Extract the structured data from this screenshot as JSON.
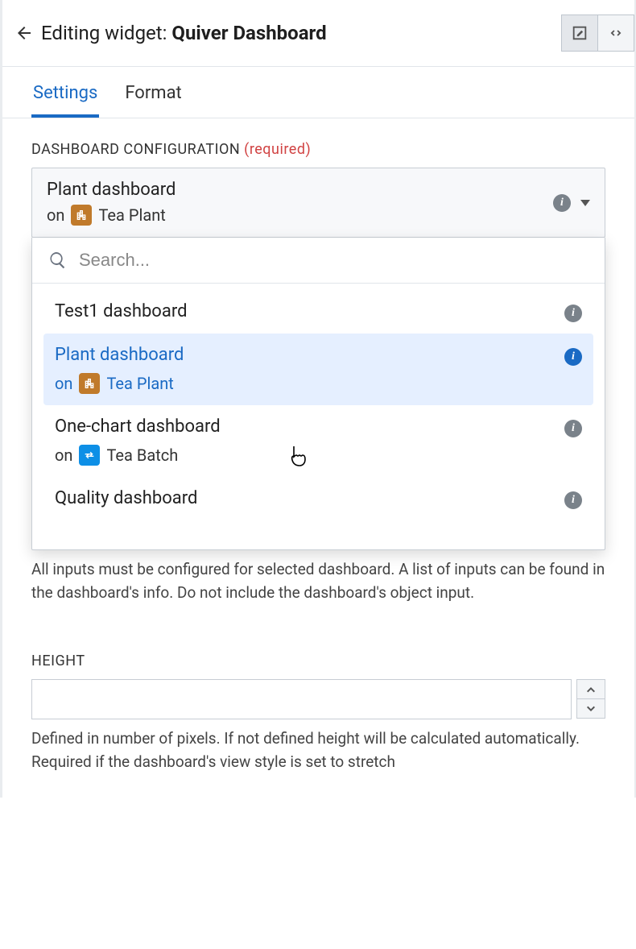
{
  "header": {
    "prefix": "Editing widget: ",
    "name": "Quiver Dashboard"
  },
  "tabs": {
    "settings": "Settings",
    "format": "Format"
  },
  "dashboardConfig": {
    "label": "DASHBOARD CONFIGURATION",
    "required": "(required)",
    "selected": {
      "title": "Plant dashboard",
      "on": "on",
      "object": "Tea Plant"
    },
    "searchPlaceholder": "Search...",
    "options": [
      {
        "title": "Test1 dashboard"
      },
      {
        "title": "Plant dashboard",
        "on": "on",
        "object": "Tea Plant",
        "iconType": "brown",
        "selected": true
      },
      {
        "title": "One-chart dashboard",
        "on": "on",
        "object": "Tea Batch",
        "iconType": "blue"
      },
      {
        "title": "Quality dashboard"
      }
    ],
    "peek": "",
    "helpText": "All inputs must be configured for selected dashboard. A list of inputs can be found in the dashboard's info. Do not include the dashboard's object input."
  },
  "height": {
    "label": "HEIGHT",
    "value": "",
    "helpText": "Defined in number of pixels. If not defined height will be calculated automatically. Required if the dashboard's view style is set to stretch"
  }
}
